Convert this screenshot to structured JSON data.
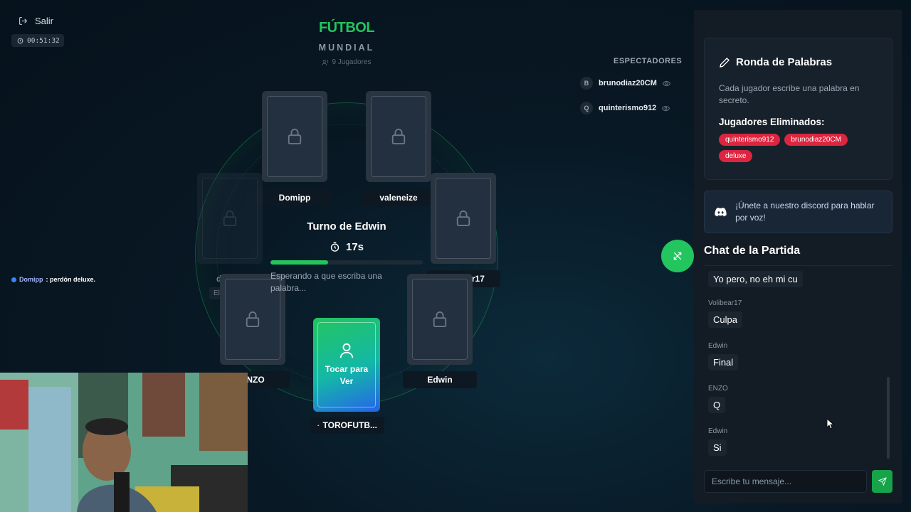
{
  "header": {
    "exit_label": "Salir",
    "elapsed": "00:51:32",
    "title": "FÚTBOL",
    "subtitle": "MUNDIAL",
    "player_count": "9 Jugadores"
  },
  "players": [
    {
      "name": "Domipp",
      "eliminated": false
    },
    {
      "name": "valeneize",
      "eliminated": false
    },
    {
      "name": "deluxe",
      "eliminated": true,
      "status": "Eliminado"
    },
    {
      "name": "Volibear17",
      "eliminated": false
    },
    {
      "name": "ENZO",
      "eliminated": false
    },
    {
      "name": "Edwin",
      "eliminated": false
    },
    {
      "name": "TOROFUTB...",
      "eliminated": false,
      "host": true
    }
  ],
  "turn": {
    "title": "Turno de Edwin",
    "time_left": "17s",
    "progress": 0.38,
    "waiting": "Esperando a que escriba una palabra..."
  },
  "reveal_card": {
    "label": "Tocar para Ver"
  },
  "spectators": {
    "title": "ESPECTADORES",
    "items": [
      {
        "initial": "B",
        "name": "brunodiaz20CM"
      },
      {
        "initial": "Q",
        "name": "quinterismo912"
      }
    ]
  },
  "overlay_message": {
    "author": "Domipp",
    "text": ": perdón deluxe."
  },
  "round": {
    "title": "Ronda de Palabras",
    "description": "Cada jugador escribe una palabra en secreto.",
    "eliminated_title": "Jugadores Eliminados:",
    "eliminated": [
      "quinterismo912",
      "brunodiaz20CM",
      "deluxe"
    ]
  },
  "discord": {
    "text": "¡Únete a nuestro discord para hablar por voz!"
  },
  "chat": {
    "title": "Chat de la Partida",
    "messages": [
      {
        "author": "",
        "text": "Yo pero, no eh mi cu"
      },
      {
        "author": "Volibear17",
        "text": "Culpa"
      },
      {
        "author": "Edwin",
        "text": "Final"
      },
      {
        "author": "ENZO",
        "text": "Q"
      },
      {
        "author": "Edwin",
        "text": "Si"
      }
    ],
    "input_placeholder": "Escribe tu mensaje..."
  },
  "colors": {
    "accent": "#22c55e",
    "danger": "#dc2640",
    "background": "#081824"
  }
}
